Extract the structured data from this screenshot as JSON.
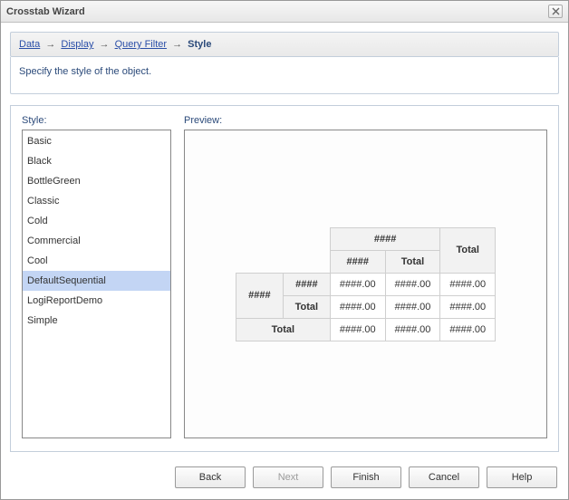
{
  "window": {
    "title": "Crosstab Wizard"
  },
  "breadcrumb": {
    "data": "Data",
    "display": "Display",
    "query_filter": "Query Filter",
    "style": "Style"
  },
  "instruction": "Specify the style of the object.",
  "labels": {
    "style": "Style:",
    "preview": "Preview:"
  },
  "styles": {
    "items": [
      "Basic",
      "Black",
      "BottleGreen",
      "Classic",
      "Cold",
      "Commercial",
      "Cool",
      "DefaultSequential",
      "LogiReportDemo",
      "Simple"
    ],
    "selected": "DefaultSequential"
  },
  "preview_table": {
    "hash": "####",
    "total": "Total",
    "num": "####.00"
  },
  "buttons": {
    "back": "Back",
    "next": "Next",
    "finish": "Finish",
    "cancel": "Cancel",
    "help": "Help"
  }
}
